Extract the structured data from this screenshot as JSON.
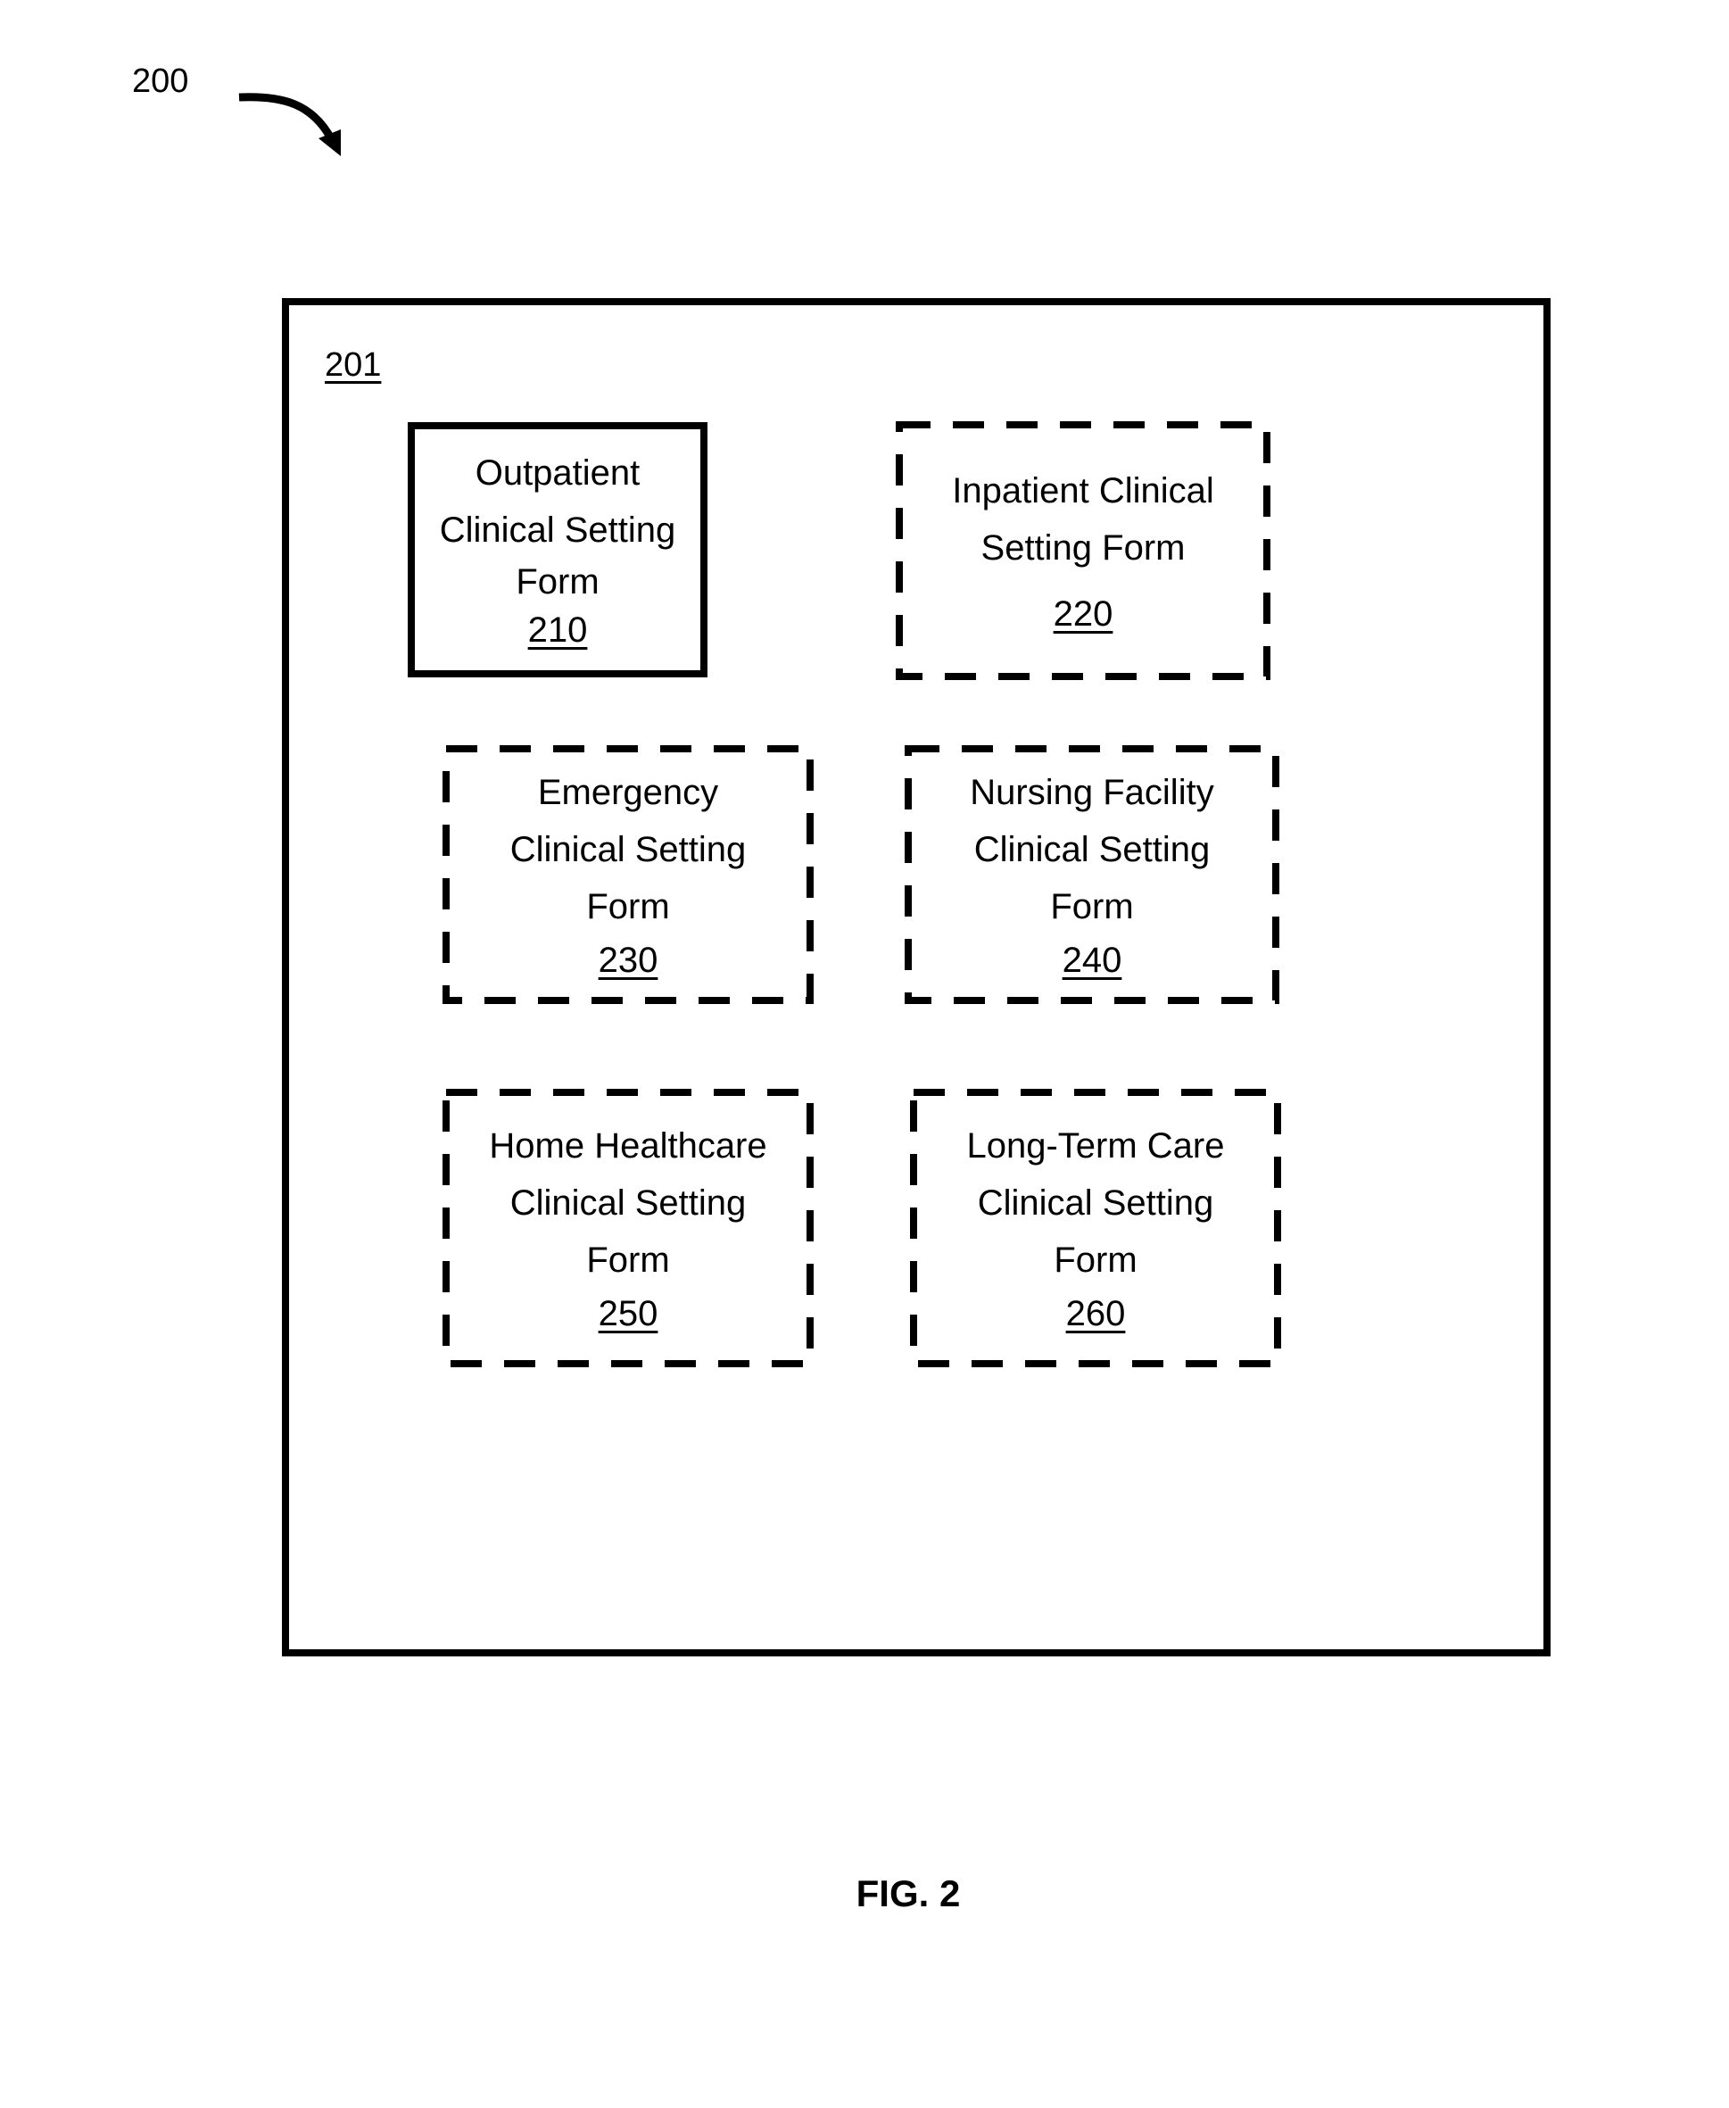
{
  "figure": {
    "reference_number": "200",
    "caption": "FIG. 2"
  },
  "container": {
    "reference_number": "201"
  },
  "forms": [
    {
      "id": "210",
      "lines": [
        "Outpatient",
        "Clinical Setting",
        "Form"
      ],
      "number": "210",
      "border": "solid"
    },
    {
      "id": "220",
      "lines": [
        "Inpatient Clinical",
        "Setting Form"
      ],
      "number": "220",
      "border": "dashed"
    },
    {
      "id": "230",
      "lines": [
        "Emergency",
        "Clinical Setting",
        "Form"
      ],
      "number": "230",
      "border": "dashed"
    },
    {
      "id": "240",
      "lines": [
        "Nursing Facility",
        "Clinical Setting",
        "Form"
      ],
      "number": "240",
      "border": "dashed"
    },
    {
      "id": "250",
      "lines": [
        "Home Healthcare",
        "Clinical Setting",
        "Form"
      ],
      "number": "250",
      "border": "dashed"
    },
    {
      "id": "260",
      "lines": [
        "Long-Term Care",
        "Clinical Setting",
        "Form"
      ],
      "number": "260",
      "border": "dashed"
    }
  ]
}
